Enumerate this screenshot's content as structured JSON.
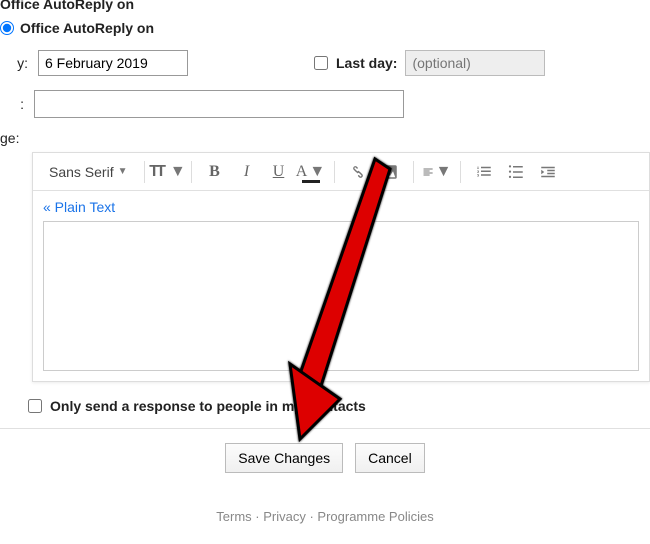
{
  "header_cutoff": "Office AutoReply on",
  "radio_label": "Office AutoReply on",
  "date": {
    "first_label": "y:",
    "first_value": "6 February 2019",
    "last_label": "Last day:",
    "last_placeholder": "(optional)"
  },
  "subject": {
    "label": ":",
    "value": ""
  },
  "msg_label": "ge:",
  "toolbar": {
    "font": "Sans Serif",
    "plain_text": "« Plain Text"
  },
  "contacts_label": "Only send a response to people in my Contacts",
  "buttons": {
    "save": "Save Changes",
    "cancel": "Cancel"
  },
  "footer": {
    "terms": "Terms",
    "privacy": "Privacy",
    "policies": "Programme Policies"
  }
}
